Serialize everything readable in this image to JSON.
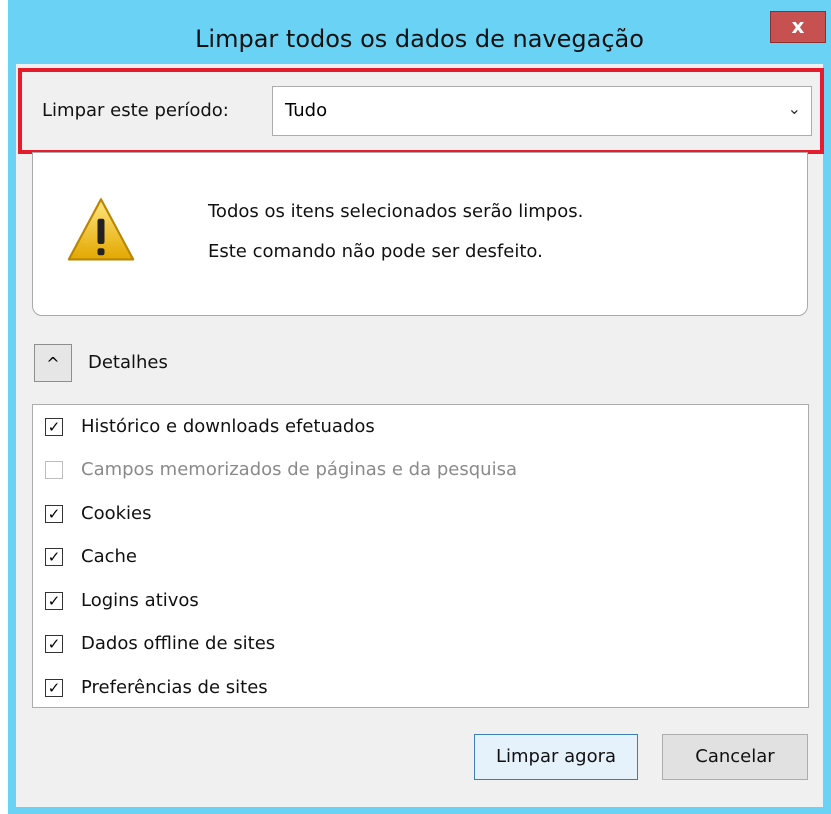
{
  "window": {
    "title": "Limpar todos os dados de navegação",
    "close_glyph": "x"
  },
  "period": {
    "label": "Limpar este período:",
    "selected": "Tudo",
    "chevron": "⌄"
  },
  "warning": {
    "icon": "warning-icon",
    "line1": "Todos os itens selecionados serão limpos.",
    "line2": "Este comando não pode ser desfeito."
  },
  "details": {
    "toggle_glyph": "^",
    "label": "Detalhes",
    "items": [
      {
        "label": "Histórico e downloads efetuados",
        "checked": true,
        "enabled": true
      },
      {
        "label": "Campos memorizados de páginas e da pesquisa",
        "checked": false,
        "enabled": false
      },
      {
        "label": "Cookies",
        "checked": true,
        "enabled": true
      },
      {
        "label": "Cache",
        "checked": true,
        "enabled": true
      },
      {
        "label": "Logins ativos",
        "checked": true,
        "enabled": true
      },
      {
        "label": "Dados offline de sites",
        "checked": true,
        "enabled": true
      },
      {
        "label": "Preferências de sites",
        "checked": true,
        "enabled": true
      }
    ]
  },
  "buttons": {
    "clear_now": "Limpar agora",
    "cancel": "Cancelar"
  },
  "colors": {
    "titlebar": "#6ad3f5",
    "highlight_border": "#e51c2c",
    "close_button": "#c75050"
  }
}
